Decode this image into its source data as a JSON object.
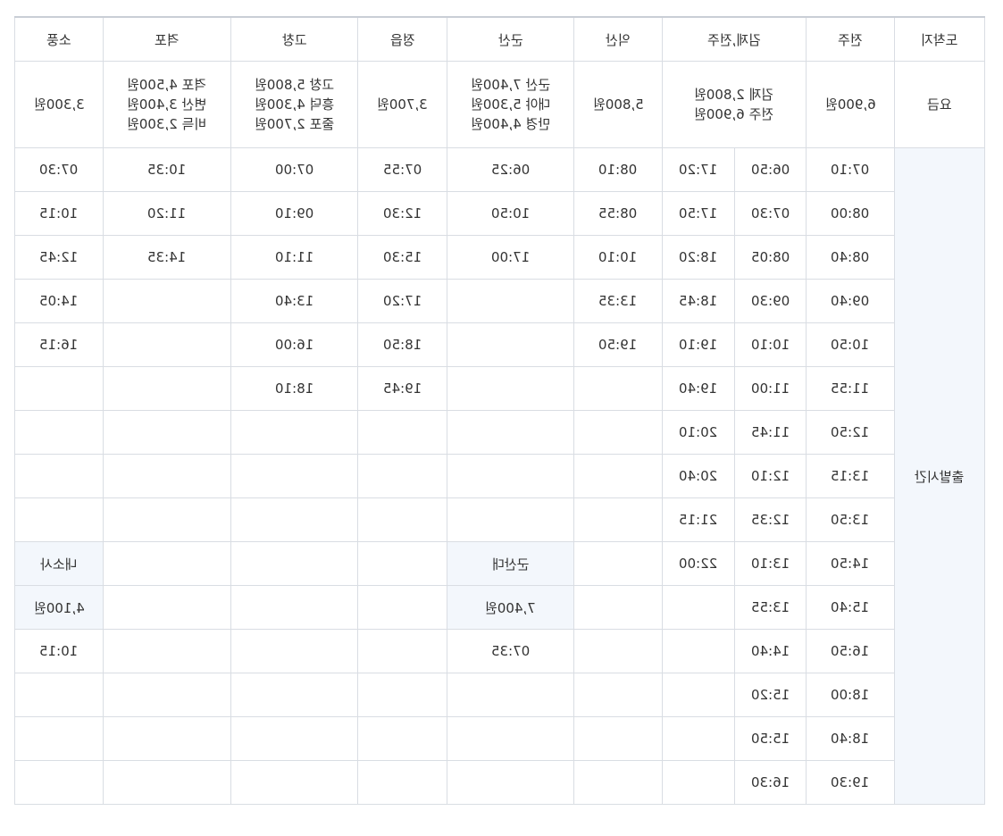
{
  "header_row": {
    "col1": "소풍",
    "col2": "격포",
    "col3": "고창",
    "col4": "정읍",
    "col5": "군산",
    "col6": "익산",
    "col7": "김제,전주",
    "col8": "전주",
    "label": "도착지"
  },
  "fare_row": {
    "col1": [
      "3,300원"
    ],
    "col2": [
      "격포 4,500원",
      "변산 3,400원",
      "비득 2,300원"
    ],
    "col3": [
      "고창 5,800원",
      "흥덕 4,300원",
      "줄포 2,700원"
    ],
    "col4": [
      "3,700원"
    ],
    "col5": [
      "군산 7,400원",
      "대야 5,300원",
      "만경 4,400원"
    ],
    "col6": [
      "5,800원"
    ],
    "col7": [
      "김제 2,800원",
      "전주 6,900원"
    ],
    "col8": [
      "6,900원"
    ],
    "label": "요금"
  },
  "departure_label": "출발시간",
  "times": {
    "c1": [
      "07:30",
      "10:15",
      "12:45",
      "14:05",
      "16:15"
    ],
    "c2": [
      "10:35",
      "11:20",
      "14:35"
    ],
    "c3": [
      "07:00",
      "09:10",
      "11:10",
      "13:40",
      "16:00",
      "18:10"
    ],
    "c4": [
      "07:55",
      "12:30",
      "15:30",
      "17:20",
      "18:50",
      "19:45"
    ],
    "c5": [
      "06:25",
      "10:50",
      "17:00"
    ],
    "c6": [
      "08:10",
      "08:55",
      "10:10",
      "13:35",
      "19:50"
    ],
    "c7a": [
      "17:20",
      "17:50",
      "18:20",
      "18:45",
      "19:10",
      "19:40",
      "20:10",
      "20:40",
      "21:15",
      "22:00"
    ],
    "c7b": [
      "06:50",
      "07:30",
      "08:05",
      "09:30",
      "10:10",
      "11:00",
      "11:45",
      "12:10",
      "12:35",
      "13:10",
      "13:55",
      "14:40",
      "15:20",
      "15:50",
      "16:30"
    ],
    "c8": [
      "07:10",
      "08:00",
      "08:40",
      "09:40",
      "10:50",
      "11:55",
      "12:50",
      "13:15",
      "13:50",
      "14:50",
      "15:40",
      "16:50",
      "18:00",
      "18:40",
      "19:30"
    ]
  },
  "sub_route_1": {
    "name": "내소사",
    "fare": "4,100원",
    "times": [
      "10:15"
    ]
  },
  "sub_route_2": {
    "name": "군산대",
    "fare": "7,400원",
    "times": [
      "07:35"
    ]
  }
}
